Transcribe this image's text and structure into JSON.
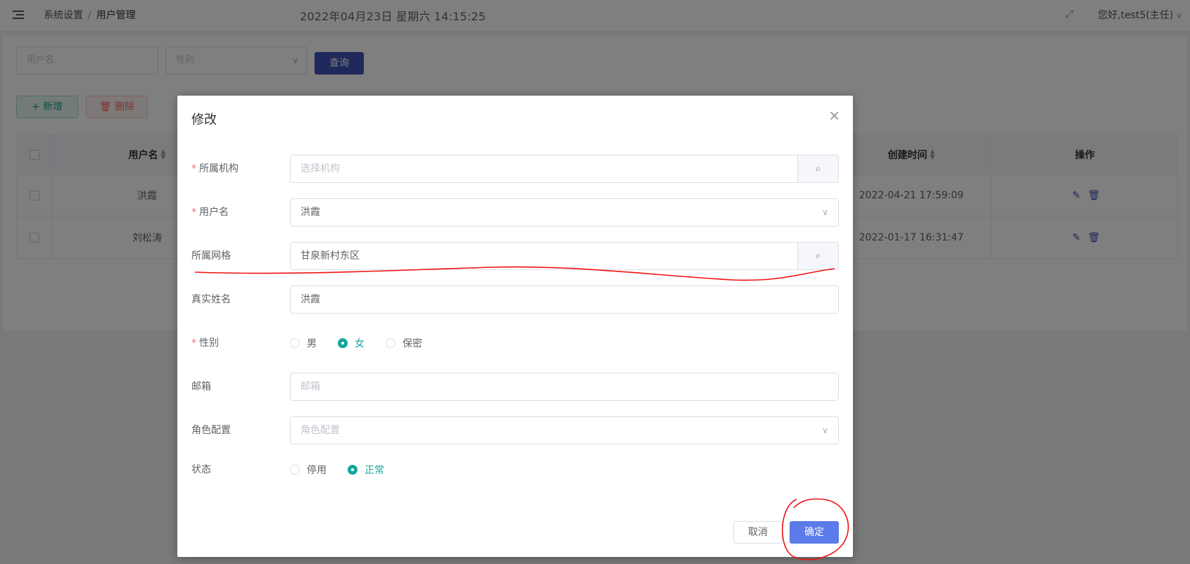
{
  "header": {
    "breadcrumb_parent": "系统设置",
    "breadcrumb_sep": "/",
    "breadcrumb_current": "用户管理",
    "datetime": "2022年04月23日  星期六  14:15:25",
    "greeting": "您好,test5(主任)",
    "greeting_arrow": "∨",
    "fullscreen_icon": "⤢"
  },
  "filters": {
    "username_placeholder": "用户名",
    "gender_placeholder": "性别",
    "query_label": "查询"
  },
  "toolbar": {
    "add_label": "+ 新增",
    "delete_label": "🗑 删除"
  },
  "table": {
    "headers": {
      "username": "用户名",
      "created": "创建时间",
      "actions": "操作"
    },
    "rows": [
      {
        "username": "洪霞",
        "created": "2022-04-21 17:59:09"
      },
      {
        "username": "刘松涛",
        "created": "2022-01-17 16:31:47"
      }
    ]
  },
  "dialog": {
    "title": "修改",
    "close": "×",
    "fields": {
      "org": {
        "label": "所属机构",
        "required": true,
        "placeholder": "选择机构",
        "value": ""
      },
      "username": {
        "label": "用户名",
        "required": true,
        "value": "洪霞"
      },
      "grid": {
        "label": "所属网格",
        "required": false,
        "value": "甘泉新村东区"
      },
      "realname": {
        "label": "真实姓名",
        "required": false,
        "value": "洪霞"
      },
      "gender": {
        "label": "性别",
        "required": true,
        "options": [
          "男",
          "女",
          "保密"
        ],
        "selected": "女"
      },
      "email": {
        "label": "邮箱",
        "required": false,
        "placeholder": "邮箱",
        "value": ""
      },
      "role": {
        "label": "角色配置",
        "required": false,
        "placeholder": "角色配置",
        "value": ""
      },
      "status": {
        "label": "状态",
        "required": false,
        "options": [
          "停用",
          "正常"
        ],
        "selected": "正常"
      }
    },
    "cancel_label": "取消",
    "ok_label": "确定"
  },
  "colors": {
    "primary": "#3f51b5",
    "accent_green": "#13a69a",
    "ok_button": "#5b7be9",
    "danger": "#f56c6c",
    "annotation": "#e11"
  }
}
